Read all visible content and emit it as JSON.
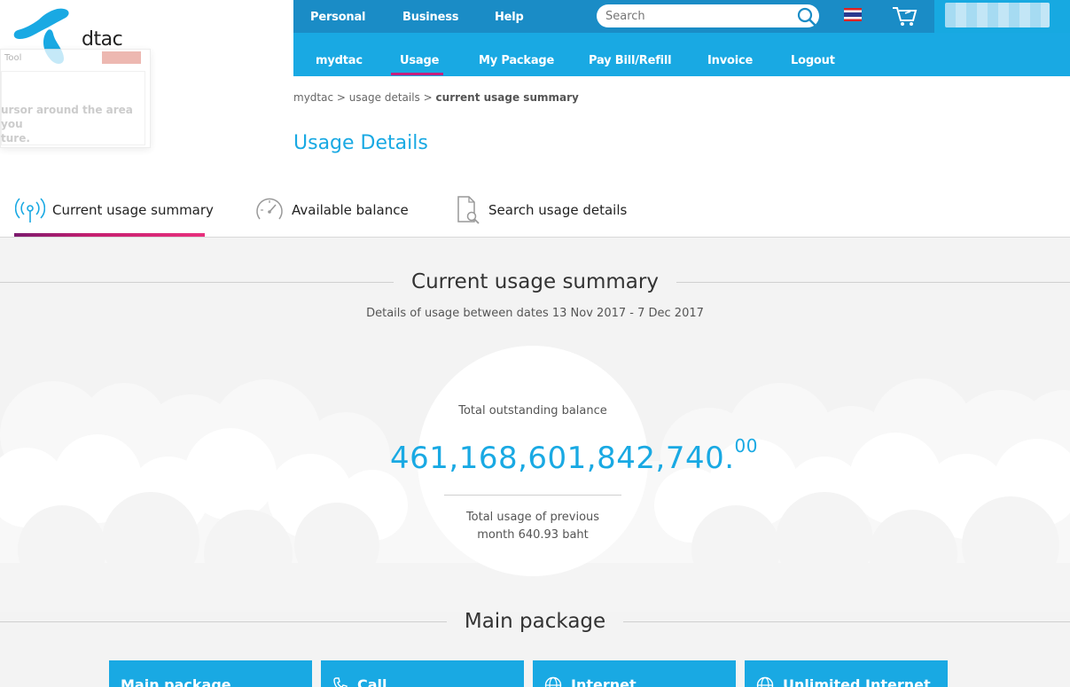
{
  "logo": {
    "text": "dtac"
  },
  "snipping_tool": {
    "title": "Tool",
    "text": "ursor around the area you\nture."
  },
  "topbar": {
    "links": [
      "Personal",
      "Business",
      "Help"
    ],
    "search_placeholder": "Search"
  },
  "nav": {
    "items": [
      "mydtac",
      "Usage",
      "My Package",
      "Pay Bill/Refill",
      "Invoice",
      "Logout"
    ],
    "active": "Usage"
  },
  "breadcrumb": {
    "item1": "mydtac",
    "sep": ">",
    "item2": "usage details",
    "current": "current usage summary"
  },
  "page_title": "Usage Details",
  "tabs": [
    {
      "label": "Current usage summary",
      "icon": "signal-icon",
      "active": true
    },
    {
      "label": "Available balance",
      "icon": "gauge-icon",
      "active": false
    },
    {
      "label": "Search usage details",
      "icon": "document-search-icon",
      "active": false
    }
  ],
  "summary": {
    "title": "Current usage summary",
    "date_range": "Details of usage between dates 13 Nov 2017 - 7 Dec 2017",
    "balance_label": "Total outstanding balance",
    "balance_main": "461,168,601,842,740.",
    "balance_decimal": "00",
    "prev_usage": "Total usage of previous\nmonth 640.93 baht"
  },
  "main_package": {
    "title": "Main package",
    "cards": [
      {
        "label": "Main package",
        "icon": ""
      },
      {
        "label": "Call",
        "icon": "phone-icon"
      },
      {
        "label": "Internet",
        "icon": "globe-icon"
      },
      {
        "label": "Unlimited Internet",
        "icon": "globe-icon"
      }
    ]
  },
  "colors": {
    "brand_blue": "#19a9e3",
    "dark_blue": "#1a8cc6",
    "accent_magenta": "#c51f7d"
  }
}
